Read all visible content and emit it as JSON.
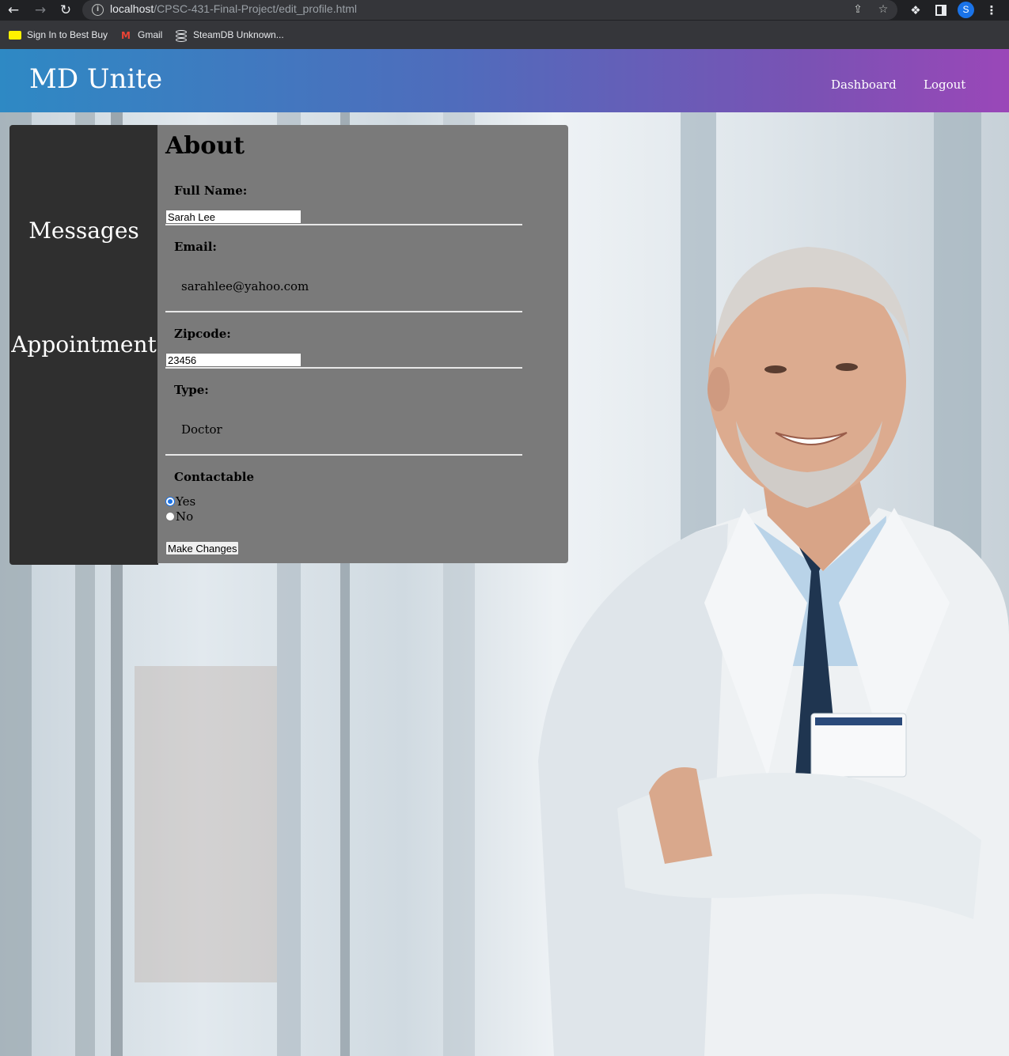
{
  "browser": {
    "url_host": "localhost",
    "url_path": "/CPSC-431-Final-Project/edit_profile.html",
    "profile_initial": "S",
    "bookmarks": [
      {
        "label": "Sign In to Best Buy",
        "icon": "bestbuy-icon"
      },
      {
        "label": "Gmail",
        "icon": "gmail-icon",
        "glyph": "M"
      },
      {
        "label": "SteamDB Unknown...",
        "icon": "steamdb-icon"
      }
    ]
  },
  "header": {
    "logo": "MD Unite",
    "nav": [
      {
        "label": "Dashboard"
      },
      {
        "label": "Logout"
      }
    ]
  },
  "sidebar": {
    "items": [
      {
        "label": "Messages"
      },
      {
        "label": "Appointment"
      }
    ]
  },
  "profile": {
    "heading": "About",
    "full_name_label": "Full Name:",
    "full_name_value": "Sarah Lee",
    "email_label": "Email:",
    "email_value": "sarahlee@yahoo.com",
    "zipcode_label": "Zipcode:",
    "zipcode_value": "23456",
    "type_label": "Type:",
    "type_value": "Doctor",
    "contactable_label": "Contactable",
    "contactable_options": [
      {
        "label": "Yes",
        "checked": true
      },
      {
        "label": "No",
        "checked": false
      }
    ],
    "submit_label": "Make Changes"
  },
  "colors": {
    "header_gradient_start": "#2e89c4",
    "header_gradient_end": "#9a47b8",
    "sidebar_bg": "#2f2f2f",
    "panel_bg": "#7a7a7a",
    "radio_checked": "#1a73e8"
  }
}
